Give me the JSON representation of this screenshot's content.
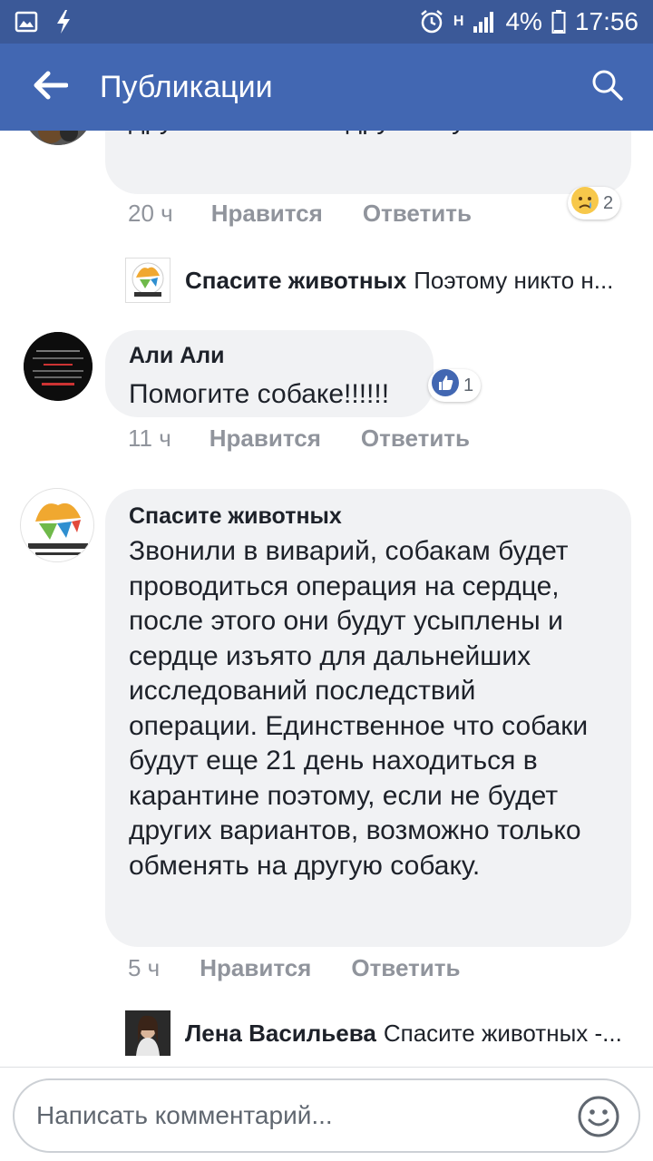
{
  "status_bar": {
    "battery": "4%",
    "time": "17:56",
    "network": "H"
  },
  "app_bar": {
    "title": "Публикации"
  },
  "comments": [
    {
      "text": "не понимаю этих выкупить на других??? А чем другие хуже??",
      "time": "20 ч",
      "like_label": "Нравится",
      "reply_label": "Ответить",
      "reaction_count": "2",
      "reaction_icon": "sad-face-icon"
    },
    {
      "reply_preview": {
        "name": "Спасите животных",
        "text": "Поэтому никто н..."
      }
    },
    {
      "author": "Али Али",
      "text": "Помогите собаке!!!!!!",
      "time": "11 ч",
      "like_label": "Нравится",
      "reply_label": "Ответить",
      "reaction_count": "1",
      "reaction_icon": "like-icon"
    },
    {
      "author": "Спасите животных",
      "text": "Звонили в виварий, собакам будет проводиться операция на сердце, после этого они будут усыплены и сердце изъято для дальнейших исследований последствий операции. Единственное что собаки будут еще 21 день находиться в карантине поэтому, если не будет других вариантов, возможно только обменять на другую собаку.",
      "time": "5 ч",
      "like_label": "Нравится",
      "reply_label": "Ответить"
    },
    {
      "reply_preview": {
        "name": "Лена Васильева",
        "text": "Спасите животных -..."
      }
    }
  ],
  "composer": {
    "placeholder": "Написать комментарий..."
  },
  "colors": {
    "status_bar": "#3b5998",
    "app_bar": "#4267b2",
    "bubble": "#f1f2f4",
    "meta_text": "#90949c",
    "like_blue": "#4267b2"
  }
}
